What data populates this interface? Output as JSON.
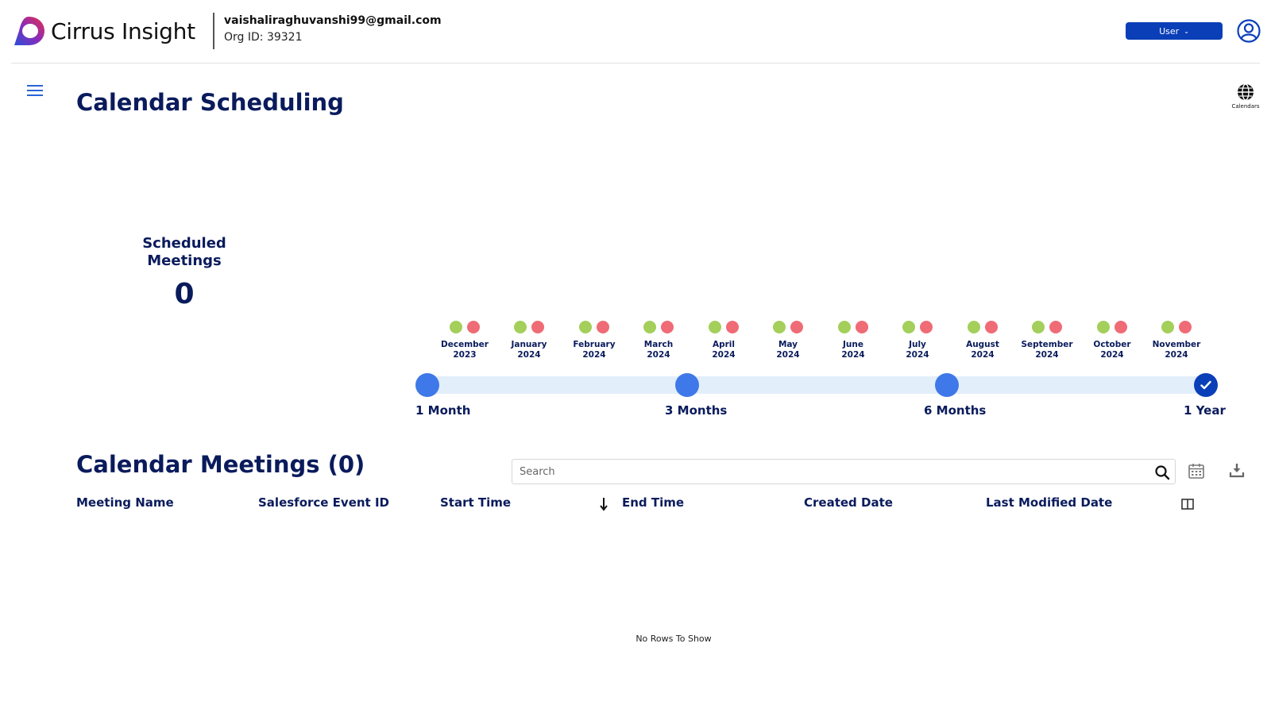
{
  "header": {
    "brand_name": "Cirrus Insight",
    "account_email": "vaishaliraghuvanshi99@gmail.com",
    "org_id": "Org ID: 39321",
    "user_button_label": "User"
  },
  "page": {
    "title": "Calendar Scheduling",
    "calendars_label": "Calendars"
  },
  "stat": {
    "label_line1": "Scheduled",
    "label_line2": "Meetings",
    "value": "0"
  },
  "timeline": {
    "months": [
      {
        "name": "December",
        "year": "2023"
      },
      {
        "name": "January",
        "year": "2024"
      },
      {
        "name": "February",
        "year": "2024"
      },
      {
        "name": "March",
        "year": "2024"
      },
      {
        "name": "April",
        "year": "2024"
      },
      {
        "name": "May",
        "year": "2024"
      },
      {
        "name": "June",
        "year": "2024"
      },
      {
        "name": "July",
        "year": "2024"
      },
      {
        "name": "August",
        "year": "2024"
      },
      {
        "name": "September",
        "year": "2024"
      },
      {
        "name": "October",
        "year": "2024"
      },
      {
        "name": "November",
        "year": "2024"
      }
    ],
    "ranges": [
      "1 Month",
      "3 Months",
      "6 Months",
      "1 Year"
    ],
    "selected_range": "1 Year"
  },
  "meetings": {
    "title": "Calendar Meetings (0)",
    "search_placeholder": "Search",
    "columns": [
      "Meeting Name",
      "Salesforce Event ID",
      "Start Time",
      "End Time",
      "Created Date",
      "Last Modified Date"
    ],
    "empty_message": "No Rows To Show"
  },
  "colors": {
    "primary": "#0a3fb8",
    "accent": "#3f78e8",
    "heading": "#0a1b5c",
    "dot_green": "#a3cf5a",
    "dot_red": "#ef6b76",
    "track": "#e3eefb"
  }
}
